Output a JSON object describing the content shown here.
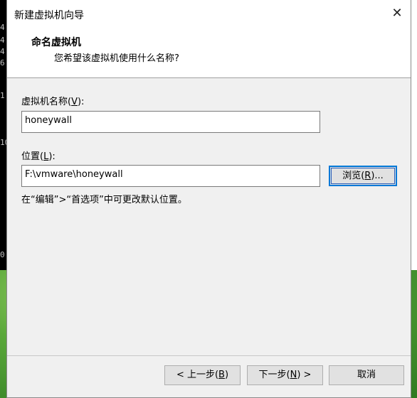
{
  "background": {
    "console_lines": [
      "4",
      "4",
      "4",
      "6",
      "1",
      "10",
      "0"
    ]
  },
  "window": {
    "title": "新建虚拟机向导",
    "close_glyph": "✕"
  },
  "header": {
    "title": "命名虚拟机",
    "subtitle": "您希望该虚拟机使用什么名称?"
  },
  "form": {
    "name_label": "虚拟机名称(",
    "name_label_key": "V",
    "name_label_end": "):",
    "name_value": "honeywall",
    "location_label": "位置(",
    "location_label_key": "L",
    "location_label_end": "):",
    "location_value": "F:\\vmware\\honeywall",
    "browse_label": "浏览(",
    "browse_key": "R",
    "browse_end": ")...",
    "hint": "在“编辑”>“首选项”中可更改默认位置。"
  },
  "footer": {
    "back_prefix": "< 上一步(",
    "back_key": "B",
    "back_suffix": ")",
    "next_prefix": "下一步(",
    "next_key": "N",
    "next_suffix": ") >",
    "cancel": "取消"
  }
}
